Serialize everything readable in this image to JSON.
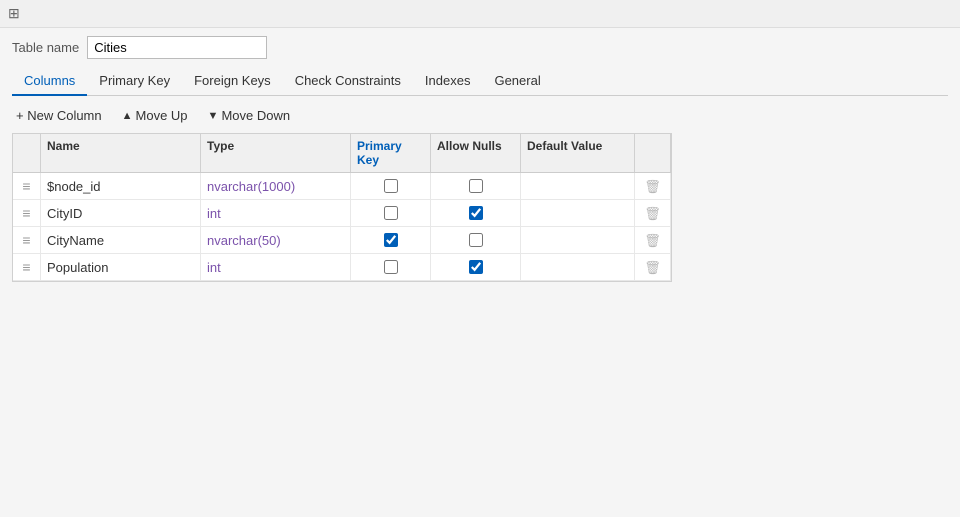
{
  "topbar": {
    "icon": "table-icon"
  },
  "tableName": {
    "label": "Table name",
    "value": "Cities"
  },
  "tabs": [
    {
      "id": "columns",
      "label": "Columns",
      "active": true
    },
    {
      "id": "primary-key",
      "label": "Primary Key",
      "active": false
    },
    {
      "id": "foreign-keys",
      "label": "Foreign Keys",
      "active": false
    },
    {
      "id": "check-constraints",
      "label": "Check Constraints",
      "active": false
    },
    {
      "id": "indexes",
      "label": "Indexes",
      "active": false
    },
    {
      "id": "general",
      "label": "General",
      "active": false
    }
  ],
  "toolbar": {
    "newColumn": "+ New Column",
    "moveUp": "Move Up",
    "moveDown": "Move Down"
  },
  "grid": {
    "headers": [
      "",
      "Name",
      "Type",
      "Primary Key",
      "Allow Nulls",
      "Default Value",
      ""
    ],
    "rows": [
      {
        "name": "$node_id",
        "type": "nvarchar(1000)",
        "primaryKey": false,
        "allowNulls": false,
        "defaultValue": ""
      },
      {
        "name": "CityID",
        "type": "int",
        "primaryKey": false,
        "allowNulls": true,
        "defaultValue": ""
      },
      {
        "name": "CityName",
        "type": "nvarchar(50)",
        "primaryKey": true,
        "allowNulls": false,
        "defaultValue": ""
      },
      {
        "name": "Population",
        "type": "int",
        "primaryKey": false,
        "allowNulls": true,
        "defaultValue": ""
      }
    ]
  }
}
